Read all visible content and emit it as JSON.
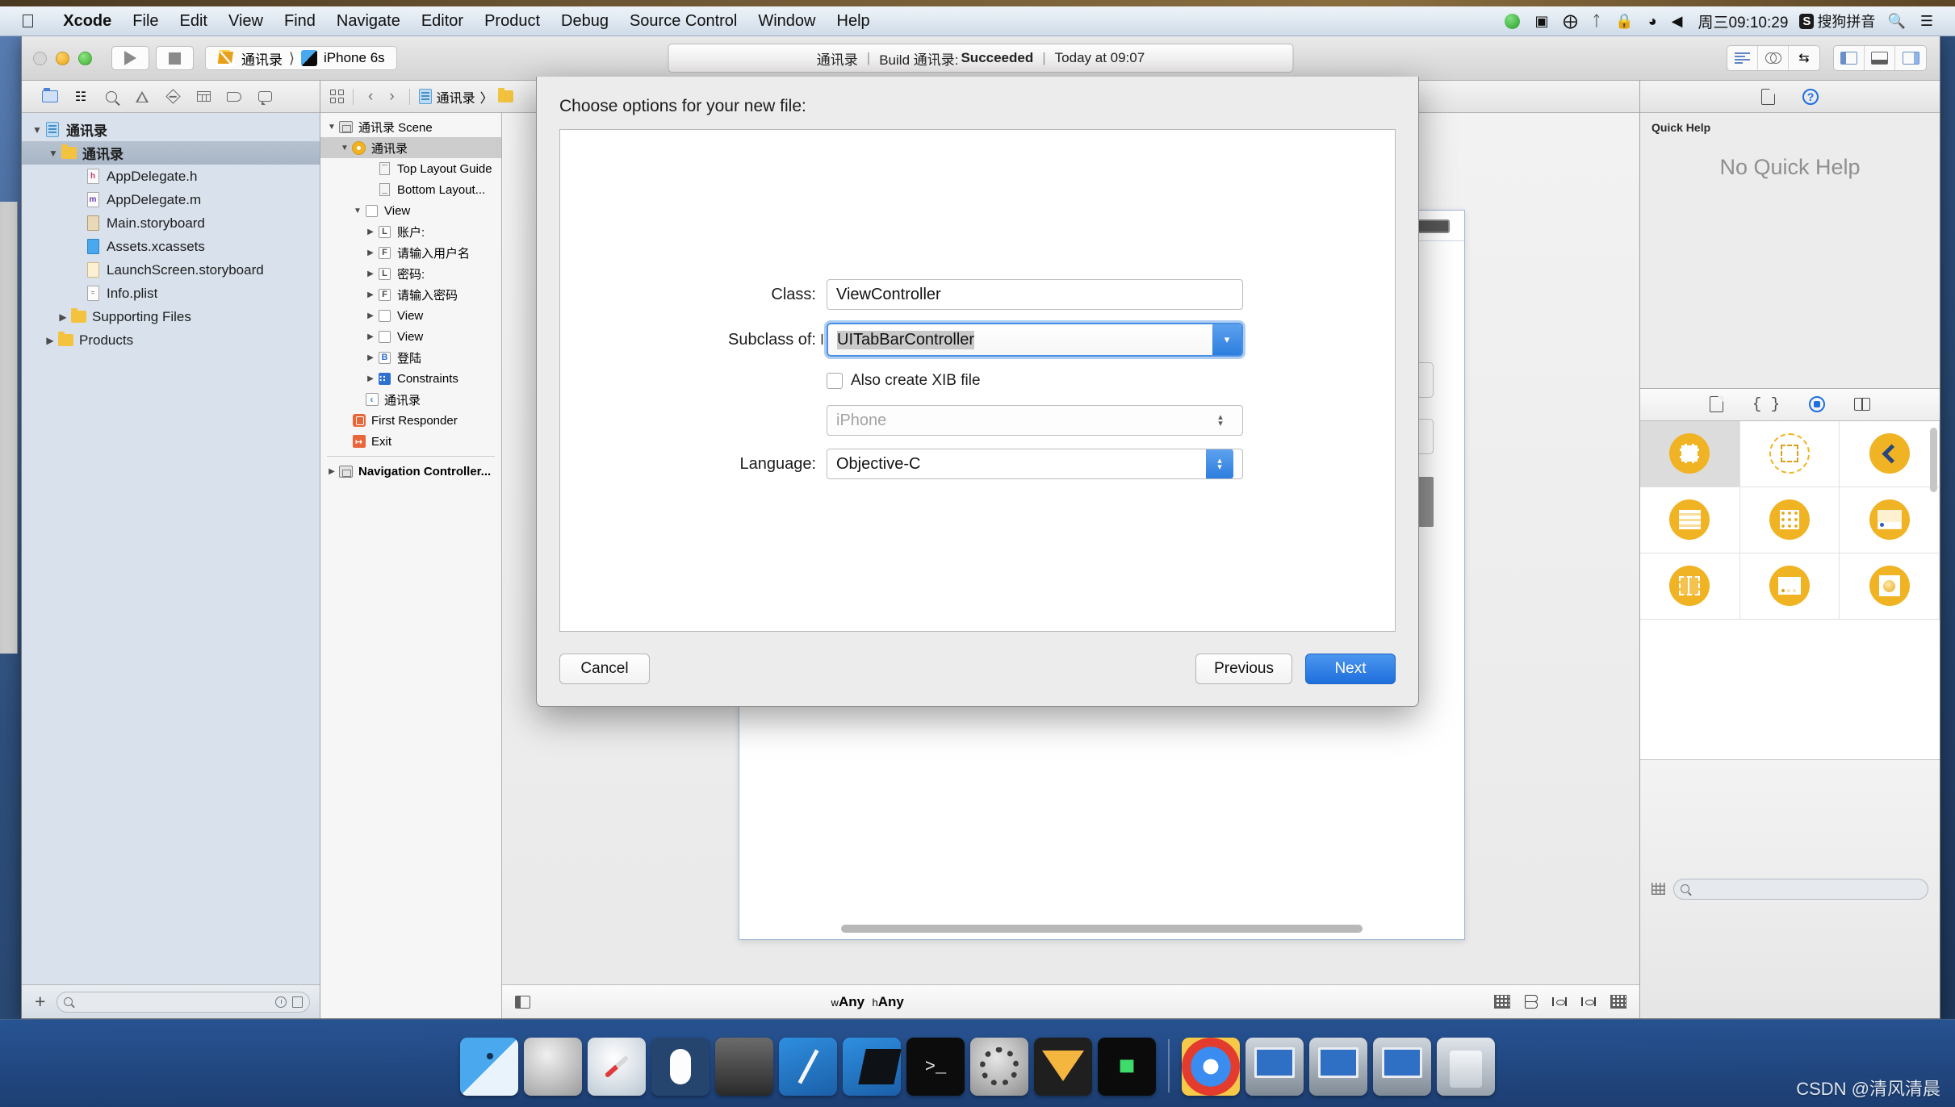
{
  "menubar": {
    "apple_icon": "apple-icon",
    "items": [
      "Xcode",
      "File",
      "Edit",
      "View",
      "Find",
      "Navigate",
      "Editor",
      "Product",
      "Debug",
      "Source Control",
      "Window",
      "Help"
    ],
    "status_icons": [
      "screen-record-icon",
      "video-camera-icon",
      "airplay-icon",
      "bluetooth-icon",
      "lock-icon",
      "wifi-icon",
      "volume-icon"
    ],
    "clock": "周三09:10:29",
    "ime_badge": "S",
    "ime_label": "搜狗拼音",
    "search_icon": "search-icon",
    "notifications_icon": "notification-center-icon"
  },
  "toolbar": {
    "run_icon": "run-play-icon",
    "stop_icon": "stop-icon",
    "scheme_project": "通讯录",
    "scheme_device": "iPhone 6s",
    "activity": {
      "project": "通讯录",
      "sep": "|",
      "build_prefix": "Build 通讯录:",
      "build_status": "Succeeded",
      "time": "Today at 09:07"
    },
    "right_icons": [
      "standard-editor-icon",
      "assistant-editor-icon",
      "version-editor-icon",
      "toggle-navigator-icon",
      "toggle-debug-area-icon",
      "toggle-utilities-icon"
    ]
  },
  "navigator": {
    "toolbar_icons": [
      "project-navigator-icon",
      "symbol-navigator-icon",
      "find-navigator-icon",
      "issue-navigator-icon",
      "test-navigator-icon",
      "debug-navigator-icon",
      "breakpoint-navigator-icon",
      "report-navigator-icon"
    ],
    "tree": [
      {
        "label": "通讯录",
        "icon": "project-icon",
        "indent": 0,
        "disclosure": "open",
        "selected": false,
        "bold": true
      },
      {
        "label": "通讯录",
        "icon": "folder-icon",
        "indent": 1,
        "disclosure": "open",
        "selected": true,
        "bold": true
      },
      {
        "label": "AppDelegate.h",
        "icon": "header-file-icon",
        "indent": 2,
        "disclosure": "none",
        "selected": false,
        "bold": false
      },
      {
        "label": "AppDelegate.m",
        "icon": "implementation-file-icon",
        "indent": 2,
        "disclosure": "none",
        "selected": false,
        "bold": false
      },
      {
        "label": "Main.storyboard",
        "icon": "storyboard-file-icon",
        "indent": 2,
        "disclosure": "none",
        "selected": false,
        "bold": false
      },
      {
        "label": "Assets.xcassets",
        "icon": "assets-catalog-icon",
        "indent": 2,
        "disclosure": "none",
        "selected": false,
        "bold": false
      },
      {
        "label": "LaunchScreen.storyboard",
        "icon": "launchscreen-file-icon",
        "indent": 2,
        "disclosure": "none",
        "selected": false,
        "bold": false
      },
      {
        "label": "Info.plist",
        "icon": "plist-file-icon",
        "indent": 2,
        "disclosure": "none",
        "selected": false,
        "bold": false
      },
      {
        "label": "Supporting Files",
        "icon": "folder-icon",
        "indent": 1,
        "disclosure": "closed",
        "selected": false,
        "bold": false
      },
      {
        "label": "Products",
        "icon": "folder-icon",
        "indent": 0,
        "disclosure": "closed",
        "selected": false,
        "bold": false
      }
    ],
    "filter_placeholder": "",
    "add_button": "+",
    "filter_icons": [
      "recent-files-icon",
      "source-control-filter-icon"
    ]
  },
  "jumpbar": {
    "related_items_icon": "related-items-icon",
    "back_icon": "back-arrow-icon",
    "forward_icon": "forward-arrow-icon",
    "crumb_project": "通讯录",
    "crumb_sep": "〉",
    "crumb_folder_icon": "folder-icon"
  },
  "outline": [
    {
      "label": "通讯录 Scene",
      "icon": "scene-icon",
      "indent": 0,
      "disclosure": "open",
      "selected": false,
      "bold": false
    },
    {
      "label": "通讯录",
      "icon": "view-controller-icon",
      "indent": 1,
      "disclosure": "open",
      "selected": true,
      "bold": false
    },
    {
      "label": "Top Layout Guide",
      "icon": "top-layout-guide-icon",
      "indent": 2,
      "disclosure": "none",
      "selected": false,
      "bold": false
    },
    {
      "label": "Bottom Layout...",
      "icon": "bottom-layout-guide-icon",
      "indent": 2,
      "disclosure": "none",
      "selected": false,
      "bold": false
    },
    {
      "label": "View",
      "icon": "view-icon",
      "indent": 2,
      "disclosure": "open",
      "selected": false,
      "bold": false
    },
    {
      "label": "账户:",
      "icon": "label-icon",
      "indent": 3,
      "disclosure": "closed",
      "selected": false,
      "bold": false
    },
    {
      "label": "请输入用户名",
      "icon": "textfield-icon",
      "indent": 3,
      "disclosure": "closed",
      "selected": false,
      "bold": false
    },
    {
      "label": "密码:",
      "icon": "label-icon",
      "indent": 3,
      "disclosure": "closed",
      "selected": false,
      "bold": false
    },
    {
      "label": "请输入密码",
      "icon": "textfield-icon",
      "indent": 3,
      "disclosure": "closed",
      "selected": false,
      "bold": false
    },
    {
      "label": "View",
      "icon": "view-icon",
      "indent": 3,
      "disclosure": "closed",
      "selected": false,
      "bold": false
    },
    {
      "label": "View",
      "icon": "view-icon",
      "indent": 3,
      "disclosure": "closed",
      "selected": false,
      "bold": false
    },
    {
      "label": "登陆",
      "icon": "button-icon",
      "indent": 3,
      "disclosure": "closed",
      "selected": false,
      "bold": false
    },
    {
      "label": "Constraints",
      "icon": "constraints-icon",
      "indent": 3,
      "disclosure": "closed",
      "selected": false,
      "bold": false
    },
    {
      "label": "通讯录",
      "icon": "navigation-item-icon",
      "indent": 2,
      "disclosure": "none",
      "selected": false,
      "bold": false
    },
    {
      "label": "First Responder",
      "icon": "first-responder-icon",
      "indent": 1,
      "disclosure": "none",
      "selected": false,
      "bold": false
    },
    {
      "label": "Exit",
      "icon": "exit-icon",
      "indent": 1,
      "disclosure": "none",
      "selected": false,
      "bold": false
    },
    {
      "label": "Navigation Controller...",
      "icon": "scene-icon",
      "indent": 0,
      "disclosure": "closed",
      "selected": false,
      "bold": true
    }
  ],
  "canvas_bar": {
    "size_class_w_prefix": "w",
    "size_class_w": "Any",
    "size_class_h_prefix": "h",
    "size_class_h": "Any",
    "icons": [
      "update-frames-icon",
      "embed-in-icon",
      "align-icon",
      "pin-icon",
      "resolve-issues-icon"
    ]
  },
  "utilities": {
    "tabs": [
      "file-inspector-icon",
      "quick-help-icon"
    ],
    "quick_help_title": "Quick Help",
    "quick_help_empty": "No Quick Help",
    "library_tabs": [
      "file-template-library-icon",
      "code-snippet-library-icon",
      "object-library-icon",
      "media-library-icon"
    ],
    "library_objects": [
      "view-controller-object",
      "storyboard-reference-object",
      "navigation-controller-object",
      "table-view-controller-object",
      "collection-view-controller-object",
      "tab-bar-controller-object",
      "split-view-controller-object",
      "page-view-controller-object",
      "glkit-view-controller-object"
    ],
    "filter_placeholder": ""
  },
  "sheet": {
    "title": "Choose options for your new file:",
    "fields": {
      "class_label": "Class:",
      "class_value": "ViewController",
      "subclass_label": "Subclass of:",
      "subclass_value": "UITabBarController",
      "xib_checkbox_label": "Also create XIB file",
      "xib_checked": false,
      "device_value": "iPhone",
      "language_label": "Language:",
      "language_value": "Objective-C"
    },
    "buttons": {
      "cancel": "Cancel",
      "previous": "Previous",
      "next": "Next"
    }
  },
  "dock": {
    "items": [
      "Finder",
      "Launchpad",
      "Safari",
      "Magic Mouse",
      "iMovie",
      "Xcode",
      "Xcode Beta",
      "Terminal",
      "System Preferences",
      "Sketch",
      "Executable",
      "Chrome",
      "Screen 1",
      "Screen 2",
      "Screen 3",
      "Trash"
    ]
  },
  "watermark": "CSDN @清风清晨"
}
